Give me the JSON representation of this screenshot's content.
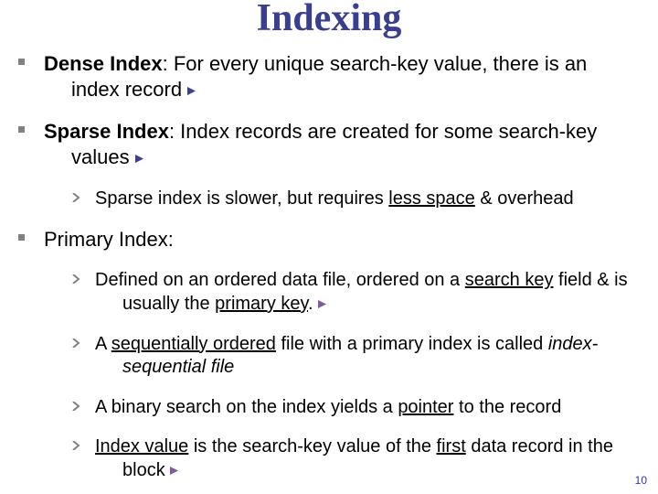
{
  "title": "Indexing",
  "items": [
    {
      "prefix_bold": "Dense Index",
      "rest": ": For every unique search-key value, there is an index record",
      "arrow_color": "#3a3e8f",
      "sub": []
    },
    {
      "prefix_bold": "Sparse Index",
      "rest": ": Index records are created for some search-key values",
      "arrow_color": "#3a3e8f",
      "sub": [
        "Sparse index is slower, but requires <span class=\"u\">less space</span> & overhead"
      ]
    },
    {
      "plain": "Primary Index:",
      "sub": [
        "Defined on an ordered data file, ordered on a <span class=\"u\">search key</span> field & is usually the <span class=\"u\">primary key</span>. <span class=\"tri\"><svg width=\"9\" height=\"9\"><polygon points=\"0,0 9,4.5 0,9\" fill=\"#805c9a\"/></svg></span>",
        "A <span class=\"u\">sequentially ordered</span> file with a primary index is called <span class=\"ital\">index-sequential file</span>",
        "A binary search on the index yields a <span class=\"u\">pointer</span> to the record",
        "<span class=\"u\">Index value</span> is the search-key value of the <span class=\"u\">first</span> data record in the block <span class=\"tri\"><svg width=\"9\" height=\"9\"><polygon points=\"0,0 9,4.5 0,9\" fill=\"#805c9a\"/></svg></span>"
      ]
    }
  ],
  "slide_number": "10"
}
